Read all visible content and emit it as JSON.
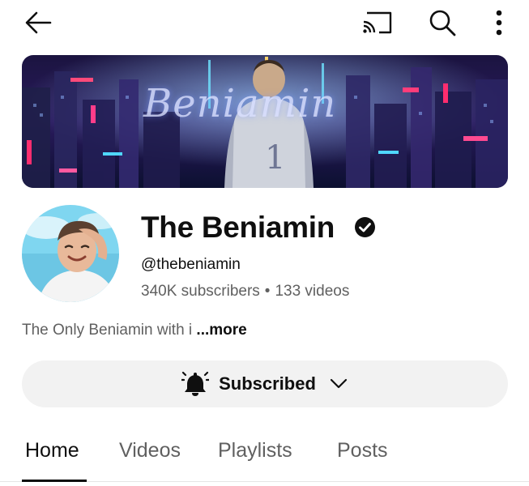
{
  "topbar": {
    "back_icon": "arrow-left-icon",
    "cast_icon": "cast-icon",
    "search_icon": "search-icon",
    "more_icon": "more-vertical-icon"
  },
  "banner": {
    "text": "Beniamin",
    "shirt_number": "1"
  },
  "channel": {
    "name": "The Beniamin",
    "verified_icon": "verified-check-icon",
    "handle": "@thebeniamin",
    "subscribers": "340K subscribers",
    "separator": "•",
    "videos": "133 videos",
    "description": "The Only Beniamin with i ",
    "more_label": "...more"
  },
  "subscribe": {
    "bell_icon": "bell-icon",
    "label": "Subscribed",
    "chevron_icon": "chevron-down-icon"
  },
  "tabs": [
    {
      "label": "Home",
      "active": true
    },
    {
      "label": "Videos",
      "active": false
    },
    {
      "label": "Playlists",
      "active": false
    },
    {
      "label": "Posts",
      "active": false
    }
  ],
  "colors": {
    "text_primary": "#0f0f0f",
    "text_secondary": "#606060",
    "button_bg": "#f2f2f2"
  }
}
